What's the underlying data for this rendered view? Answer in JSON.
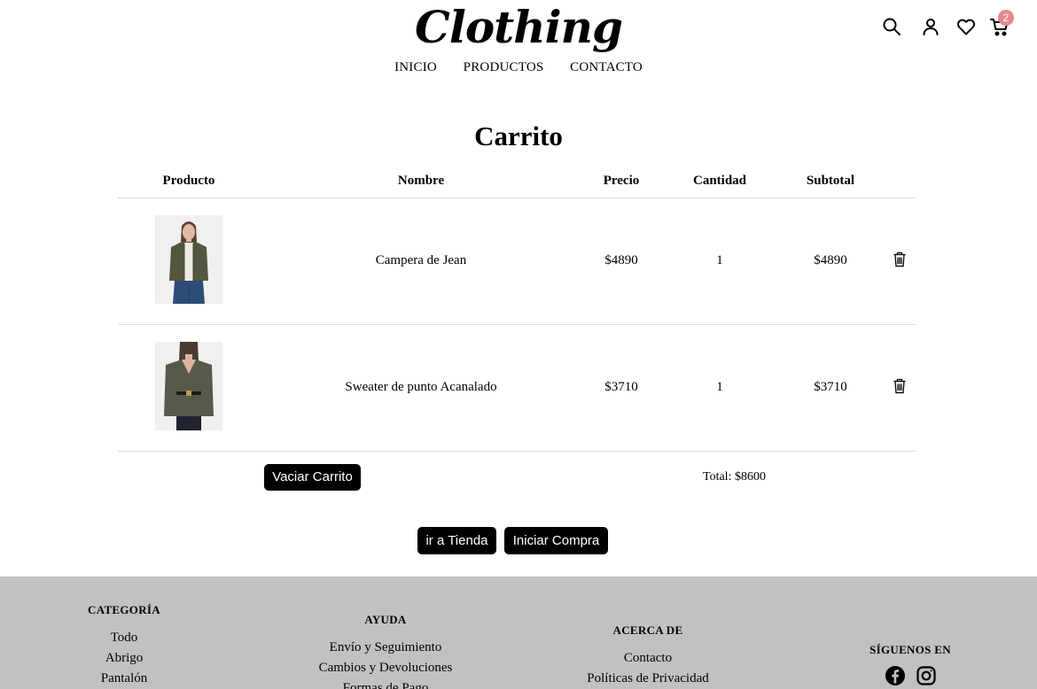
{
  "header": {
    "logo_text": "Clothing",
    "nav": [
      "INICIO",
      "PRODUCTOS",
      "CONTACTO"
    ],
    "icons": [
      "search-icon",
      "user-icon",
      "heart-icon",
      "cart-icon"
    ],
    "cart_count": "2",
    "badge_color": "#e5888a"
  },
  "page": {
    "title": "Carrito"
  },
  "table": {
    "headers": [
      "Producto",
      "Nombre",
      "Precio",
      "Cantidad",
      "Subtotal"
    ],
    "rows": [
      {
        "name": "Campera de Jean",
        "price": "$4890",
        "quantity": "1",
        "subtotal": "$4890"
      },
      {
        "name": "Sweater de punto Acanalado",
        "price": "$3710",
        "quantity": "1",
        "subtotal": "$3710"
      }
    ]
  },
  "actions": {
    "empty_cart": "Vaciar Carrito",
    "total": "Total: $8600",
    "go_store": "ir a Tienda",
    "checkout": "Iniciar Compra"
  },
  "footer": {
    "categoria": {
      "title": "CATEGORÍA",
      "links": [
        "Todo",
        "Abrigo",
        "Pantalón"
      ]
    },
    "ayuda": {
      "title": "AYUDA",
      "links": [
        "Envío y Seguimiento",
        "Cambios y Devoluciones",
        "Formas de Pago"
      ]
    },
    "acerca": {
      "title": "ACERCA DE",
      "links": [
        "Contacto",
        "Políticas de Privacidad"
      ]
    },
    "siguenos": {
      "title": "SÍGUENOS EN",
      "icons": [
        "facebook-icon",
        "instagram-icon"
      ]
    },
    "background": "#c3c1c0"
  }
}
